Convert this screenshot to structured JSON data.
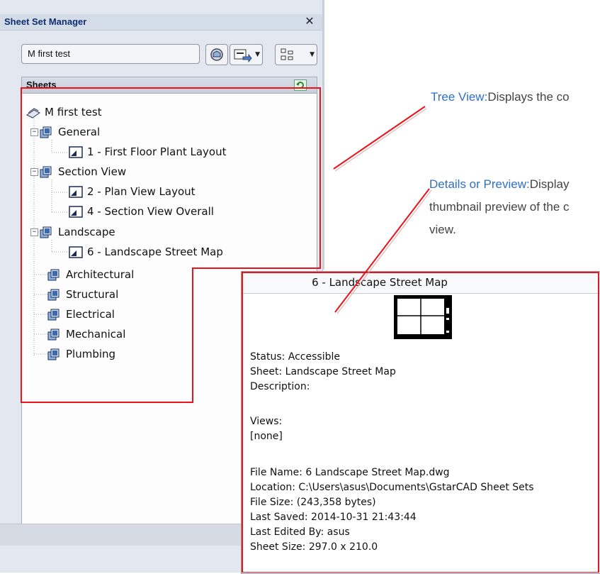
{
  "palette": {
    "title": "Sheet Set Manager",
    "close_glyph": "✕",
    "sheet_set_value": "M first test",
    "toolbar_icons": [
      "sheetset-wizard-icon",
      "publish-icon",
      "view-options-icon"
    ]
  },
  "sheets_panel": {
    "header": "Sheets",
    "root": "M first test",
    "groups": [
      {
        "label": "General",
        "sheets": [
          "1 - First Floor Plant Layout"
        ]
      },
      {
        "label": "Section View",
        "sheets": [
          "2 - Plan View Layout",
          "4 - Section View Overall"
        ]
      },
      {
        "label": "Landscape",
        "sheets": [
          "6 - Landscape Street Map"
        ]
      },
      {
        "label": "Architectural",
        "sheets": []
      },
      {
        "label": "Structural",
        "sheets": []
      },
      {
        "label": "Electrical",
        "sheets": []
      },
      {
        "label": "Mechanical",
        "sheets": []
      },
      {
        "label": "Plumbing",
        "sheets": []
      }
    ]
  },
  "callouts": {
    "tree_view": {
      "key": "Tree View:",
      "text": "Displays the co"
    },
    "details": {
      "key": "Details or Preview:",
      "text": "Display",
      "line2": "thumbnail preview of the c",
      "line3": "view."
    }
  },
  "details": {
    "title": "6 - Landscape Street Map",
    "status": "Status: Accessible",
    "sheet": "Sheet: Landscape Street Map",
    "description": "Description:",
    "views_label": "Views:",
    "views_value": "[none]",
    "file_name": "File Name: 6 Landscape Street Map.dwg",
    "location": "Location: C:\\Users\\asus\\Documents\\GstarCAD Sheet Sets",
    "file_size": "File Size:  (243,358 bytes)",
    "last_saved": "Last Saved: 2014-10-31 21:43:44",
    "last_edited": "Last Edited By: asus",
    "sheet_size": "Sheet Size: 297.0 x 210.0"
  },
  "colors": {
    "highlight": "#e8141c",
    "callout_key": "#2f6fc6",
    "title_text": "#0e2f72"
  }
}
